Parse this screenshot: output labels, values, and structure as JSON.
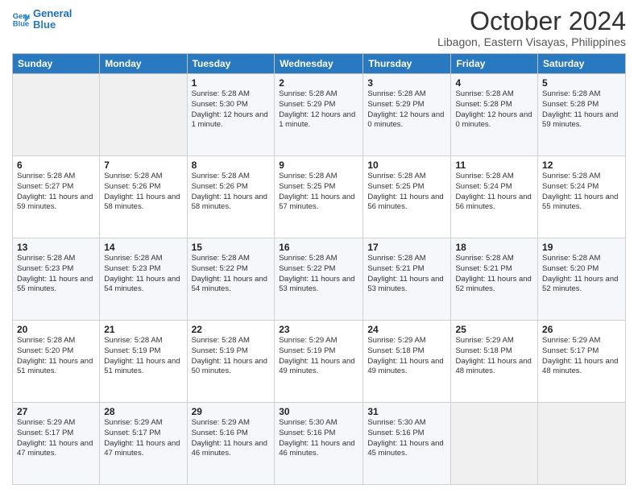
{
  "header": {
    "logo_line1": "General",
    "logo_line2": "Blue",
    "month": "October 2024",
    "location": "Libagon, Eastern Visayas, Philippines"
  },
  "weekdays": [
    "Sunday",
    "Monday",
    "Tuesday",
    "Wednesday",
    "Thursday",
    "Friday",
    "Saturday"
  ],
  "weeks": [
    [
      {
        "day": "",
        "info": ""
      },
      {
        "day": "",
        "info": ""
      },
      {
        "day": "1",
        "info": "Sunrise: 5:28 AM\nSunset: 5:30 PM\nDaylight: 12 hours and 1 minute."
      },
      {
        "day": "2",
        "info": "Sunrise: 5:28 AM\nSunset: 5:29 PM\nDaylight: 12 hours and 1 minute."
      },
      {
        "day": "3",
        "info": "Sunrise: 5:28 AM\nSunset: 5:29 PM\nDaylight: 12 hours and 0 minutes."
      },
      {
        "day": "4",
        "info": "Sunrise: 5:28 AM\nSunset: 5:28 PM\nDaylight: 12 hours and 0 minutes."
      },
      {
        "day": "5",
        "info": "Sunrise: 5:28 AM\nSunset: 5:28 PM\nDaylight: 11 hours and 59 minutes."
      }
    ],
    [
      {
        "day": "6",
        "info": "Sunrise: 5:28 AM\nSunset: 5:27 PM\nDaylight: 11 hours and 59 minutes."
      },
      {
        "day": "7",
        "info": "Sunrise: 5:28 AM\nSunset: 5:26 PM\nDaylight: 11 hours and 58 minutes."
      },
      {
        "day": "8",
        "info": "Sunrise: 5:28 AM\nSunset: 5:26 PM\nDaylight: 11 hours and 58 minutes."
      },
      {
        "day": "9",
        "info": "Sunrise: 5:28 AM\nSunset: 5:25 PM\nDaylight: 11 hours and 57 minutes."
      },
      {
        "day": "10",
        "info": "Sunrise: 5:28 AM\nSunset: 5:25 PM\nDaylight: 11 hours and 56 minutes."
      },
      {
        "day": "11",
        "info": "Sunrise: 5:28 AM\nSunset: 5:24 PM\nDaylight: 11 hours and 56 minutes."
      },
      {
        "day": "12",
        "info": "Sunrise: 5:28 AM\nSunset: 5:24 PM\nDaylight: 11 hours and 55 minutes."
      }
    ],
    [
      {
        "day": "13",
        "info": "Sunrise: 5:28 AM\nSunset: 5:23 PM\nDaylight: 11 hours and 55 minutes."
      },
      {
        "day": "14",
        "info": "Sunrise: 5:28 AM\nSunset: 5:23 PM\nDaylight: 11 hours and 54 minutes."
      },
      {
        "day": "15",
        "info": "Sunrise: 5:28 AM\nSunset: 5:22 PM\nDaylight: 11 hours and 54 minutes."
      },
      {
        "day": "16",
        "info": "Sunrise: 5:28 AM\nSunset: 5:22 PM\nDaylight: 11 hours and 53 minutes."
      },
      {
        "day": "17",
        "info": "Sunrise: 5:28 AM\nSunset: 5:21 PM\nDaylight: 11 hours and 53 minutes."
      },
      {
        "day": "18",
        "info": "Sunrise: 5:28 AM\nSunset: 5:21 PM\nDaylight: 11 hours and 52 minutes."
      },
      {
        "day": "19",
        "info": "Sunrise: 5:28 AM\nSunset: 5:20 PM\nDaylight: 11 hours and 52 minutes."
      }
    ],
    [
      {
        "day": "20",
        "info": "Sunrise: 5:28 AM\nSunset: 5:20 PM\nDaylight: 11 hours and 51 minutes."
      },
      {
        "day": "21",
        "info": "Sunrise: 5:28 AM\nSunset: 5:19 PM\nDaylight: 11 hours and 51 minutes."
      },
      {
        "day": "22",
        "info": "Sunrise: 5:28 AM\nSunset: 5:19 PM\nDaylight: 11 hours and 50 minutes."
      },
      {
        "day": "23",
        "info": "Sunrise: 5:29 AM\nSunset: 5:19 PM\nDaylight: 11 hours and 49 minutes."
      },
      {
        "day": "24",
        "info": "Sunrise: 5:29 AM\nSunset: 5:18 PM\nDaylight: 11 hours and 49 minutes."
      },
      {
        "day": "25",
        "info": "Sunrise: 5:29 AM\nSunset: 5:18 PM\nDaylight: 11 hours and 48 minutes."
      },
      {
        "day": "26",
        "info": "Sunrise: 5:29 AM\nSunset: 5:17 PM\nDaylight: 11 hours and 48 minutes."
      }
    ],
    [
      {
        "day": "27",
        "info": "Sunrise: 5:29 AM\nSunset: 5:17 PM\nDaylight: 11 hours and 47 minutes."
      },
      {
        "day": "28",
        "info": "Sunrise: 5:29 AM\nSunset: 5:17 PM\nDaylight: 11 hours and 47 minutes."
      },
      {
        "day": "29",
        "info": "Sunrise: 5:29 AM\nSunset: 5:16 PM\nDaylight: 11 hours and 46 minutes."
      },
      {
        "day": "30",
        "info": "Sunrise: 5:30 AM\nSunset: 5:16 PM\nDaylight: 11 hours and 46 minutes."
      },
      {
        "day": "31",
        "info": "Sunrise: 5:30 AM\nSunset: 5:16 PM\nDaylight: 11 hours and 45 minutes."
      },
      {
        "day": "",
        "info": ""
      },
      {
        "day": "",
        "info": ""
      }
    ]
  ]
}
